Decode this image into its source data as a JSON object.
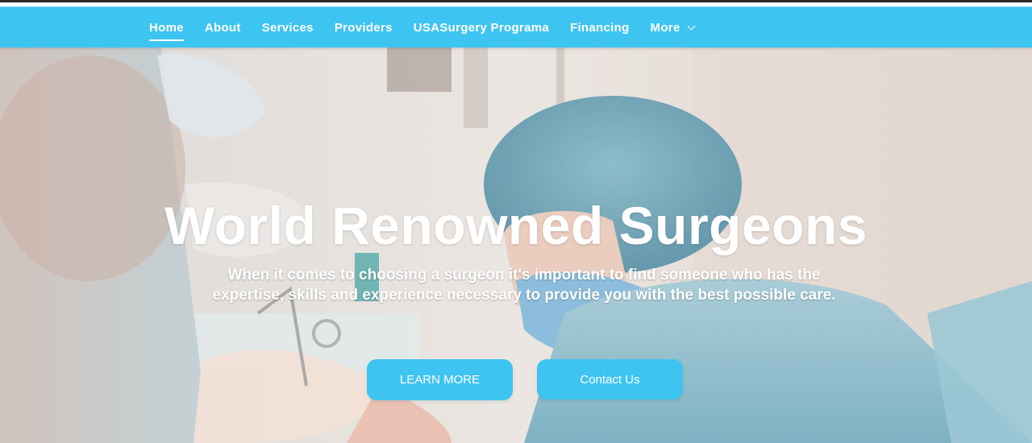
{
  "nav": {
    "items": [
      {
        "label": "Home",
        "active": true
      },
      {
        "label": "About"
      },
      {
        "label": "Services"
      },
      {
        "label": "Providers"
      },
      {
        "label": "USASurgery Programa"
      },
      {
        "label": "Financing"
      },
      {
        "label": "More",
        "has_dropdown": true
      }
    ]
  },
  "hero": {
    "title": "World Renowned Surgeons",
    "subtitle": "When it comes to choosing a surgeon it's important to find someone who has the expertise, skills and experience necessary to provide you with the best possible care.",
    "buttons": {
      "learn_more": "LEARN MORE",
      "contact": "Contact Us"
    }
  },
  "colors": {
    "brand": "#3ec4f0",
    "text_on_brand": "#ffffff"
  },
  "icons": {
    "more_dropdown": "chevron-down-icon"
  }
}
